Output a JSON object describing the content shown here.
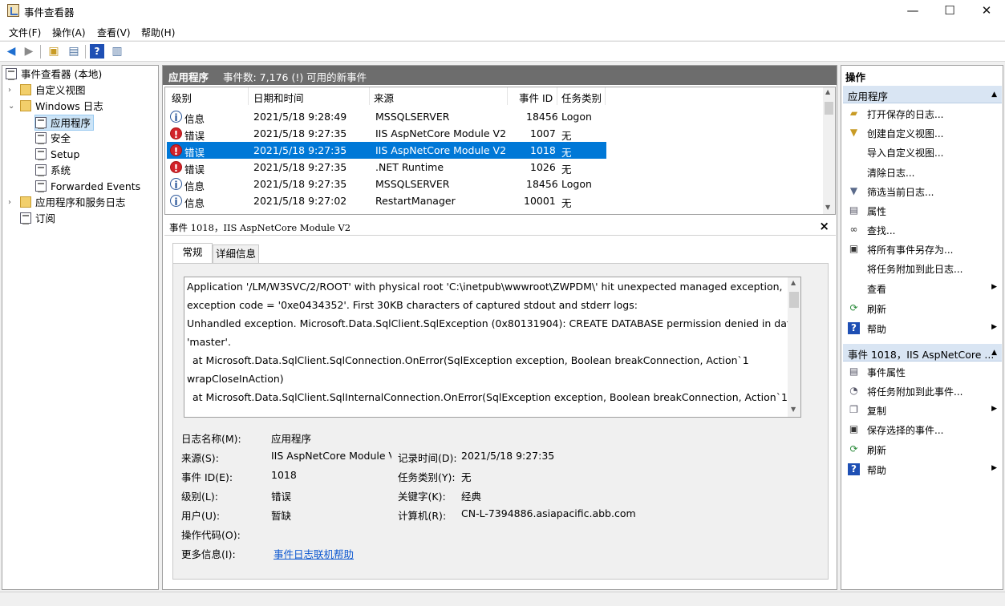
{
  "window": {
    "title": "事件查看器",
    "min": "—",
    "max": "☐",
    "close": "✕"
  },
  "menu": [
    "文件(F)",
    "操作(A)",
    "查看(V)",
    "帮助(H)"
  ],
  "tree": {
    "root": "事件查看器 (本地)",
    "custom_views": "自定义视图",
    "windows_logs": "Windows 日志",
    "app": "应用程序",
    "security": "安全",
    "setup": "Setup",
    "system": "系统",
    "forwarded": "Forwarded Events",
    "app_service_logs": "应用程序和服务日志",
    "subscriptions": "订阅"
  },
  "list": {
    "title": "应用程序",
    "count": "事件数: 7,176 (!) 可用的新事件",
    "headers": {
      "level": "级别",
      "date": "日期和时间",
      "source": "来源",
      "id": "事件 ID",
      "task": "任务类别"
    },
    "rows": [
      {
        "level": "信息",
        "date": "2021/5/18 9:28:49",
        "source": "MSSQLSERVER",
        "id": "18456",
        "task": "Logon",
        "type": "info"
      },
      {
        "level": "错误",
        "date": "2021/5/18 9:27:35",
        "source": "IIS AspNetCore Module V2",
        "id": "1007",
        "task": "无",
        "type": "err"
      },
      {
        "level": "错误",
        "date": "2021/5/18 9:27:35",
        "source": "IIS AspNetCore Module V2",
        "id": "1018",
        "task": "无",
        "type": "err",
        "selected": true
      },
      {
        "level": "错误",
        "date": "2021/5/18 9:27:35",
        "source": ".NET Runtime",
        "id": "1026",
        "task": "无",
        "type": "err"
      },
      {
        "level": "信息",
        "date": "2021/5/18 9:27:35",
        "source": "MSSQLSERVER",
        "id": "18456",
        "task": "Logon",
        "type": "info"
      },
      {
        "level": "信息",
        "date": "2021/5/18 9:27:02",
        "source": "RestartManager",
        "id": "10001",
        "task": "无",
        "type": "info"
      }
    ]
  },
  "detail": {
    "title": "事件 1018，IIS AspNetCore Module V2",
    "tab_general": "常规",
    "tab_details": "详细信息",
    "message": [
      "Application '/LM/W3SVC/2/ROOT' with physical root 'C:\\inetpub\\wwwroot\\ZWPDM\\' hit unexpected managed exception,",
      "exception code = '0xe0434352'. First 30KB characters of captured stdout and stderr logs:",
      "Unhandled exception. Microsoft.Data.SqlClient.SqlException (0x80131904): CREATE DATABASE permission denied in database",
      "'master'.",
      "   at Microsoft.Data.SqlClient.SqlConnection.OnError(SqlException exception, Boolean breakConnection, Action`1",
      "wrapCloseInAction)",
      "   at Microsoft.Data.SqlClient.SqlInternalConnection.OnError(SqlException exception, Boolean breakConnection, Action`1"
    ],
    "fields": {
      "log_name_label": "日志名称(M):",
      "log_name": "应用程序",
      "source_label": "来源(S):",
      "source": "IIS AspNetCore Module V",
      "logged_label": "记录时间(D):",
      "logged": "2021/5/18 9:27:35",
      "id_label": "事件 ID(E):",
      "id": "1018",
      "task_label": "任务类别(Y):",
      "task": "无",
      "level_label": "级别(L):",
      "level": "错误",
      "keywords_label": "关键字(K):",
      "keywords": "经典",
      "user_label": "用户(U):",
      "user": "暂缺",
      "computer_label": "计算机(R):",
      "computer": "CN-L-7394886.asiapacific.abb.com",
      "opcode_label": "操作代码(O):",
      "more_label": "更多信息(I):",
      "more_link": "事件日志联机帮助"
    }
  },
  "actions": {
    "header": "操作",
    "sec1": "应用程序",
    "sec1_items": [
      "打开保存的日志...",
      "创建自定义视图...",
      "导入自定义视图...",
      "清除日志...",
      "筛选当前日志...",
      "属性",
      "查找...",
      "将所有事件另存为...",
      "将任务附加到此日志...",
      "查看",
      "刷新",
      "帮助"
    ],
    "sec2": "事件 1018，IIS AspNetCore ...",
    "sec2_items": [
      "事件属性",
      "将任务附加到此事件...",
      "复制",
      "保存选择的事件...",
      "刷新",
      "帮助"
    ]
  }
}
